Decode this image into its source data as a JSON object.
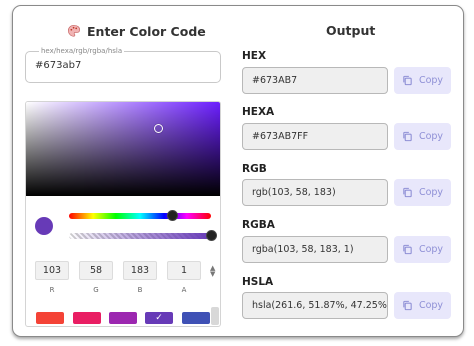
{
  "left": {
    "title": "Enter Color Code",
    "input": {
      "legend": "hex/hexa/rgb/rgba/hsla",
      "value": "#673ab7"
    },
    "picker": {
      "current_color": "#673ab7",
      "channels": [
        {
          "label": "R",
          "value": "103"
        },
        {
          "label": "G",
          "value": "58"
        },
        {
          "label": "B",
          "value": "183"
        },
        {
          "label": "A",
          "value": "1"
        }
      ],
      "presets": [
        "#f44336",
        "#e91e63",
        "#9c27b0",
        "#673ab7",
        "#3f51b5"
      ],
      "selected_preset": 3
    }
  },
  "right": {
    "title": "Output",
    "copy_label": "Copy",
    "outputs": [
      {
        "label": "HEX",
        "value": "#673AB7"
      },
      {
        "label": "HEXA",
        "value": "#673AB7FF"
      },
      {
        "label": "RGB",
        "value": "rgb(103, 58, 183)"
      },
      {
        "label": "RGBA",
        "value": "rgba(103, 58, 183, 1)"
      },
      {
        "label": "HSLA",
        "value": "hsla(261.6, 51.87%, 47.25%"
      }
    ]
  },
  "colors": {
    "accent_button_bg": "#e8e7fb",
    "accent_button_text": "#8f90d6"
  }
}
